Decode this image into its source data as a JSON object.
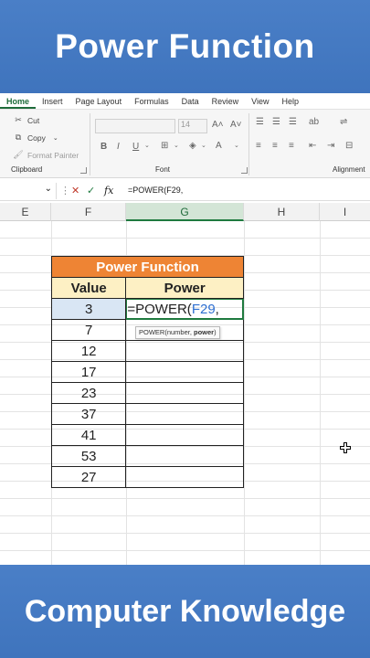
{
  "banner": {
    "top": "Power Function",
    "bottom": "Computer Knowledge"
  },
  "ribbon_tabs": [
    "Home",
    "Insert",
    "Page Layout",
    "Formulas",
    "Data",
    "Review",
    "View",
    "Help"
  ],
  "ribbon": {
    "cut": "Cut",
    "copy": "Copy",
    "format_painter": "Format Painter",
    "clipboard_label": "Clipboard",
    "font_label": "Font",
    "alignment_label": "Alignment",
    "font_size": "14",
    "bold": "B",
    "italic": "I",
    "underline": "U"
  },
  "formula_bar": {
    "fx": "fx",
    "content": "=POWER(F29,"
  },
  "column_headers": [
    "E",
    "F",
    "G",
    "H",
    "I"
  ],
  "table": {
    "title": "Power Function",
    "headers": [
      "Value",
      "Power"
    ],
    "values": [
      "3",
      "7",
      "12",
      "17",
      "23",
      "37",
      "41",
      "53",
      "27"
    ],
    "editing_prefix": "=POWER(",
    "editing_ref": "F29",
    "editing_suffix": ","
  },
  "tooltip": {
    "prefix": "POWER(number, ",
    "bold": "power",
    "suffix": ")"
  },
  "colors": {
    "banner": "#3f74bd",
    "title_fill": "#ee8434",
    "header_fill": "#fdf0c4",
    "selected_col": "#d3e5d6"
  }
}
